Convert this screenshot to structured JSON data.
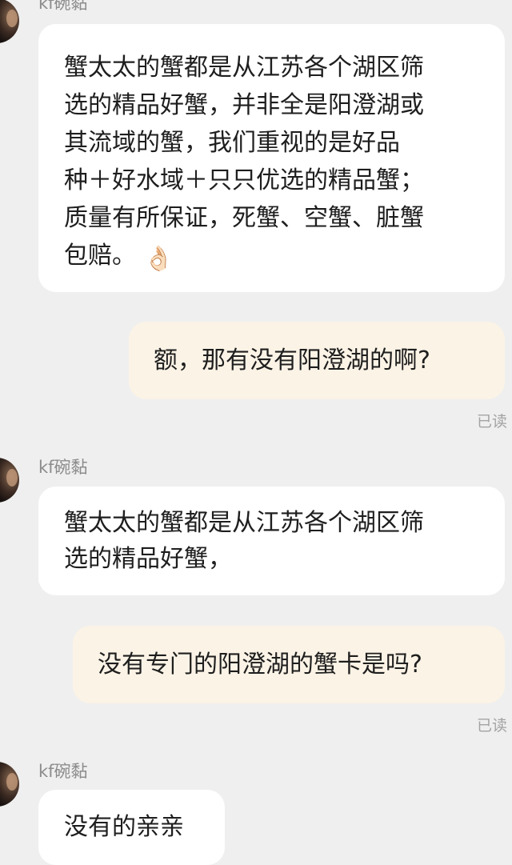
{
  "chat": {
    "sender_name": "kf碗黏",
    "read_receipt": "已读",
    "messages": [
      {
        "lines": [
          "蟹太太的蟹都是从江苏各个湖区筛",
          "选的精品好蟹，并非全是阳澄湖或",
          "其流域的蟹，我们重视的是好品",
          "种＋好水域＋只只优选的精品蟹；",
          "质量有所保证，死蟹、空蟹、脏蟹",
          "包赔。"
        ],
        "emoji": "👌🏻"
      },
      {
        "text": "额，那有没有阳澄湖的啊?"
      },
      {
        "lines": [
          "蟹太太的蟹都是从江苏各个湖区筛",
          "选的精品好蟹，"
        ]
      },
      {
        "text": "没有专门的阳澄湖的蟹卡是吗?"
      },
      {
        "text": "没有的亲亲"
      }
    ]
  }
}
